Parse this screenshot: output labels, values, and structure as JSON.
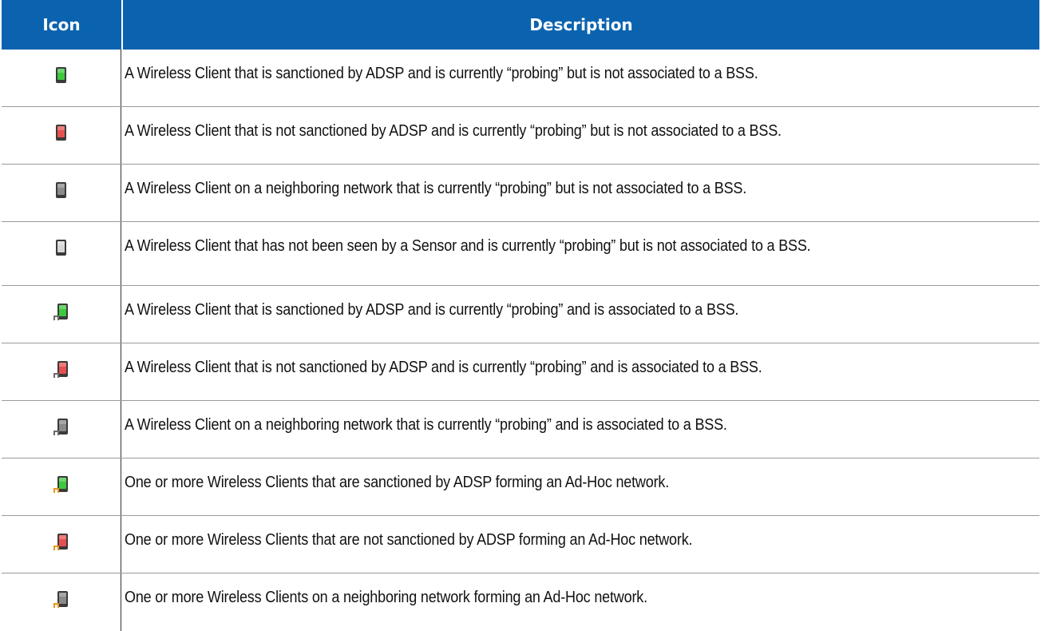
{
  "table": {
    "headers": {
      "icon": "Icon",
      "description": "Description"
    },
    "rows": [
      {
        "icon": "client-probing-sanctioned-icon",
        "color": "#3ec83e",
        "badge": "none",
        "description": "A Wireless Client that is sanctioned by ADSP and is currently “probing” but is not associated to a BSS."
      },
      {
        "icon": "client-probing-unsanctioned-icon",
        "color": "#e85050",
        "badge": "none",
        "description": "A Wireless Client that is not sanctioned by ADSP and is currently “probing” but is not associated to a BSS."
      },
      {
        "icon": "client-probing-neighbor-icon",
        "color": "#8a8a8a",
        "badge": "none",
        "description": "A Wireless Client on a neighboring network that is currently “probing” but is not associated to a BSS."
      },
      {
        "icon": "client-probing-unseen-icon",
        "color": "#d6d6d6",
        "badge": "none",
        "description": "A Wireless Client that has not been seen by a Sensor and is currently “probing” but is not associated to a BSS."
      },
      {
        "icon": "client-associated-sanctioned-icon",
        "color": "#3ec83e",
        "badge": "gray",
        "description": "A Wireless Client that is sanctioned by ADSP and is currently “probing” and is associated to a BSS."
      },
      {
        "icon": "client-associated-unsanctioned-icon",
        "color": "#e85050",
        "badge": "gray",
        "description": "A Wireless Client that is not sanctioned by ADSP and is currently “probing” and is associated to a BSS."
      },
      {
        "icon": "client-associated-neighbor-icon",
        "color": "#8a8a8a",
        "badge": "gray",
        "description": "A Wireless Client on a neighboring network that is currently “probing” and is associated to a BSS."
      },
      {
        "icon": "client-adhoc-sanctioned-icon",
        "color": "#3ec83e",
        "badge": "orange",
        "description": "One or more Wireless Clients that are sanctioned by ADSP forming an Ad-Hoc network."
      },
      {
        "icon": "client-adhoc-unsanctioned-icon",
        "color": "#e85050",
        "badge": "orange",
        "description": "One or more Wireless Clients that are not sanctioned by ADSP forming an Ad-Hoc network."
      },
      {
        "icon": "client-adhoc-neighbor-icon",
        "color": "#8a8a8a",
        "badge": "orange",
        "description": "One or more Wireless Clients on a neighboring network forming an Ad-Hoc network."
      }
    ]
  }
}
